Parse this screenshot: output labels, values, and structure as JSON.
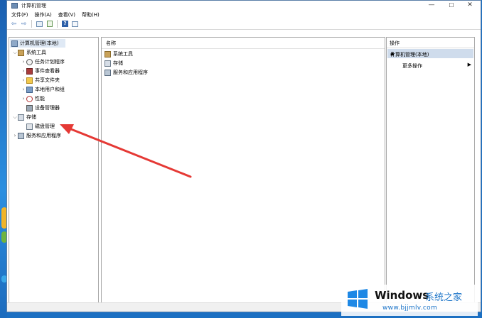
{
  "window": {
    "title": "计算机管理"
  },
  "titlebar": {
    "minimize": "—",
    "maximize": "☐",
    "close": "✕"
  },
  "menu": [
    "文件(F)",
    "操作(A)",
    "查看(V)",
    "帮助(H)"
  ],
  "tree": {
    "root": "计算机管理(本地)",
    "system_tools": "系统工具",
    "task_scheduler": "任务计划程序",
    "event_viewer": "事件查看器",
    "shared_folders": "共享文件夹",
    "local_users": "本地用户和组",
    "performance": "性能",
    "device_manager": "设备管理器",
    "storage": "存储",
    "disk_management": "磁盘管理",
    "services_apps": "服务和应用程序"
  },
  "center": {
    "column_header": "名称",
    "items": [
      "系统工具",
      "存储",
      "服务和应用程序"
    ]
  },
  "actions": {
    "header": "操作",
    "group_title": "计算机管理(本地)",
    "more_actions": "更多操作"
  },
  "watermark": {
    "brand": "Windows",
    "site_name": "系统之家",
    "url": "www.bjjmlv.com"
  },
  "colors": {
    "desktop": "#1b6fc2",
    "selection": "#dfe9f5",
    "action_group": "#cfdcec",
    "annotation_arrow": "#e53935"
  },
  "icons": [
    "back-icon",
    "forward-icon",
    "console-tree-icon",
    "export-icon",
    "help-icon",
    "properties-icon"
  ]
}
